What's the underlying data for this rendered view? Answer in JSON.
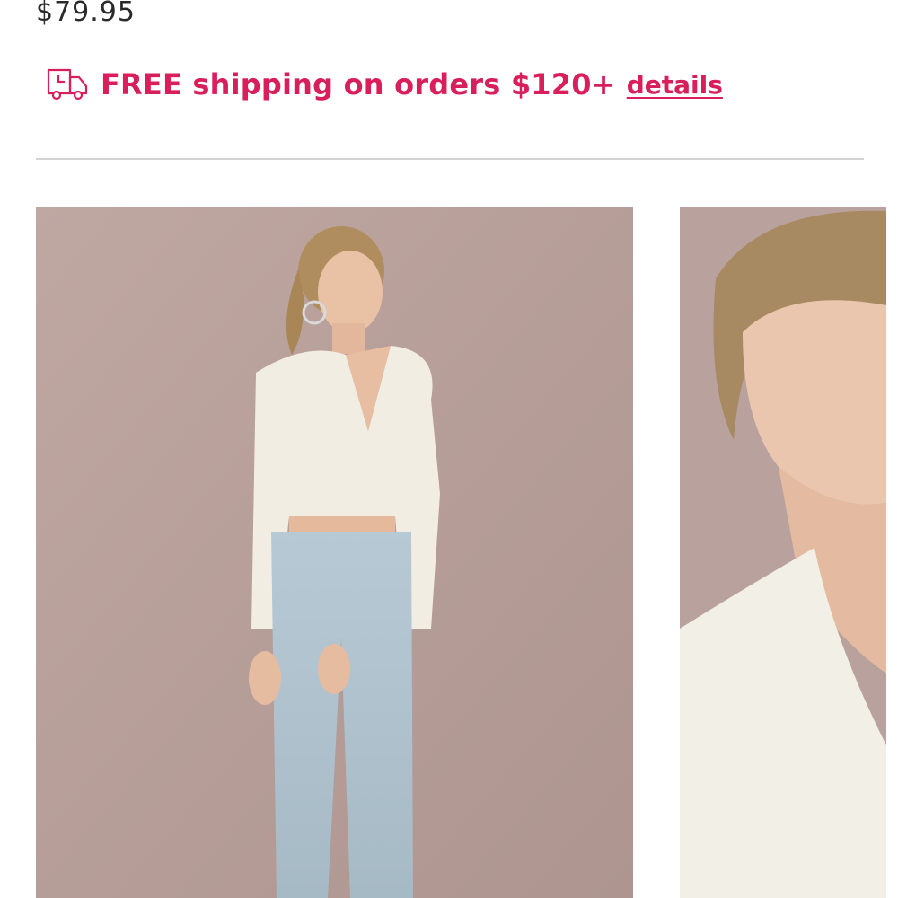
{
  "product": {
    "price": "$79.95"
  },
  "shipping_banner": {
    "icon": "delivery-truck-icon",
    "text": "FREE shipping on orders $120+",
    "link_label": "details",
    "color": "#d81e5b"
  },
  "gallery": {
    "images": [
      {
        "alt": "Model wearing white wrap crop top with light wash jeans"
      },
      {
        "alt": "Close-up of model smiling in white wrap top"
      }
    ]
  }
}
